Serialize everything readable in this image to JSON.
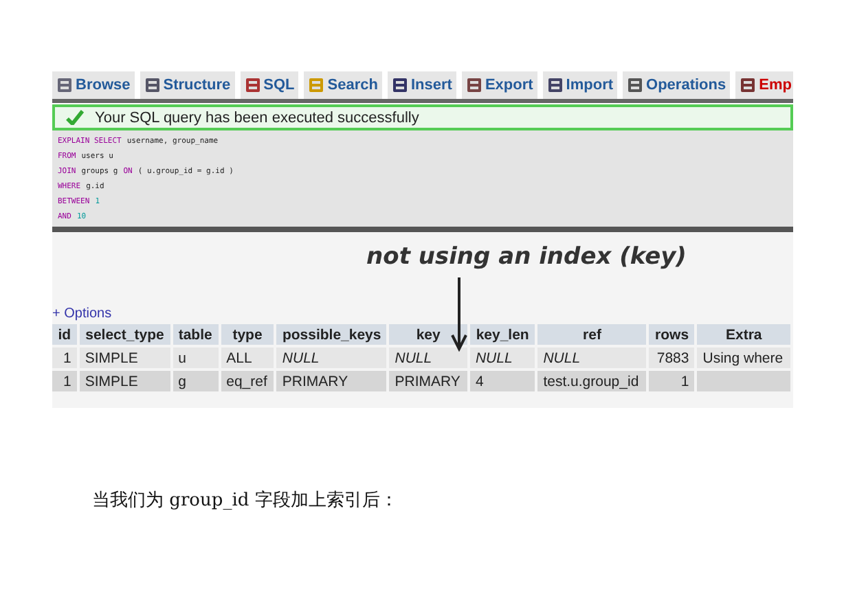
{
  "tabs": [
    {
      "label": "Browse",
      "kind": "normal"
    },
    {
      "label": "Structure",
      "kind": "normal"
    },
    {
      "label": "SQL",
      "kind": "normal"
    },
    {
      "label": "Search",
      "kind": "normal"
    },
    {
      "label": "Insert",
      "kind": "normal"
    },
    {
      "label": "Export",
      "kind": "normal"
    },
    {
      "label": "Import",
      "kind": "normal"
    },
    {
      "label": "Operations",
      "kind": "normal"
    },
    {
      "label": "Emp",
      "kind": "danger"
    }
  ],
  "success_message": "Your SQL query has been executed successfully",
  "sql_lines": [
    [
      {
        "text": "EXPLAIN SELECT",
        "kind": "keyword"
      },
      {
        "text": "username, group_name",
        "kind": "ident"
      }
    ],
    [
      {
        "text": "FROM",
        "kind": "keyword"
      },
      {
        "text": "users u",
        "kind": "ident"
      }
    ],
    [
      {
        "text": "JOIN",
        "kind": "keyword"
      },
      {
        "text": "groups g",
        "kind": "ident"
      },
      {
        "text": "ON",
        "kind": "keyword"
      },
      {
        "text": "( u.group_id = g.id )",
        "kind": "ident"
      }
    ],
    [
      {
        "text": "WHERE",
        "kind": "keyword"
      },
      {
        "text": "g.id",
        "kind": "ident"
      }
    ],
    [
      {
        "text": "BETWEEN",
        "kind": "keyword"
      },
      {
        "text": "1",
        "kind": "number"
      }
    ],
    [
      {
        "text": "AND",
        "kind": "keyword"
      },
      {
        "text": "10",
        "kind": "number"
      }
    ]
  ],
  "annotation": "not using an index (key)",
  "options_link": "+ Options",
  "table": {
    "columns": [
      "id",
      "select_type",
      "table",
      "type",
      "possible_keys",
      "key",
      "key_len",
      "ref",
      "rows",
      "Extra"
    ],
    "rows": [
      [
        {
          "text": "1",
          "italic": false
        },
        {
          "text": "SIMPLE",
          "italic": false
        },
        {
          "text": "u",
          "italic": false
        },
        {
          "text": "ALL",
          "italic": false
        },
        {
          "text": "NULL",
          "italic": true
        },
        {
          "text": "NULL",
          "italic": true
        },
        {
          "text": "NULL",
          "italic": true
        },
        {
          "text": "NULL",
          "italic": true
        },
        {
          "text": "7883",
          "italic": false
        },
        {
          "text": "Using where",
          "italic": false
        }
      ],
      [
        {
          "text": "1",
          "italic": false
        },
        {
          "text": "SIMPLE",
          "italic": false
        },
        {
          "text": "g",
          "italic": false
        },
        {
          "text": "eq_ref",
          "italic": false
        },
        {
          "text": "PRIMARY",
          "italic": false
        },
        {
          "text": "PRIMARY",
          "italic": false
        },
        {
          "text": "4",
          "italic": false
        },
        {
          "text": "test.u.group_id",
          "italic": false
        },
        {
          "text": "1",
          "italic": false
        }
      ]
    ]
  },
  "caption": "当我们为 group_id 字段加上索引后："
}
